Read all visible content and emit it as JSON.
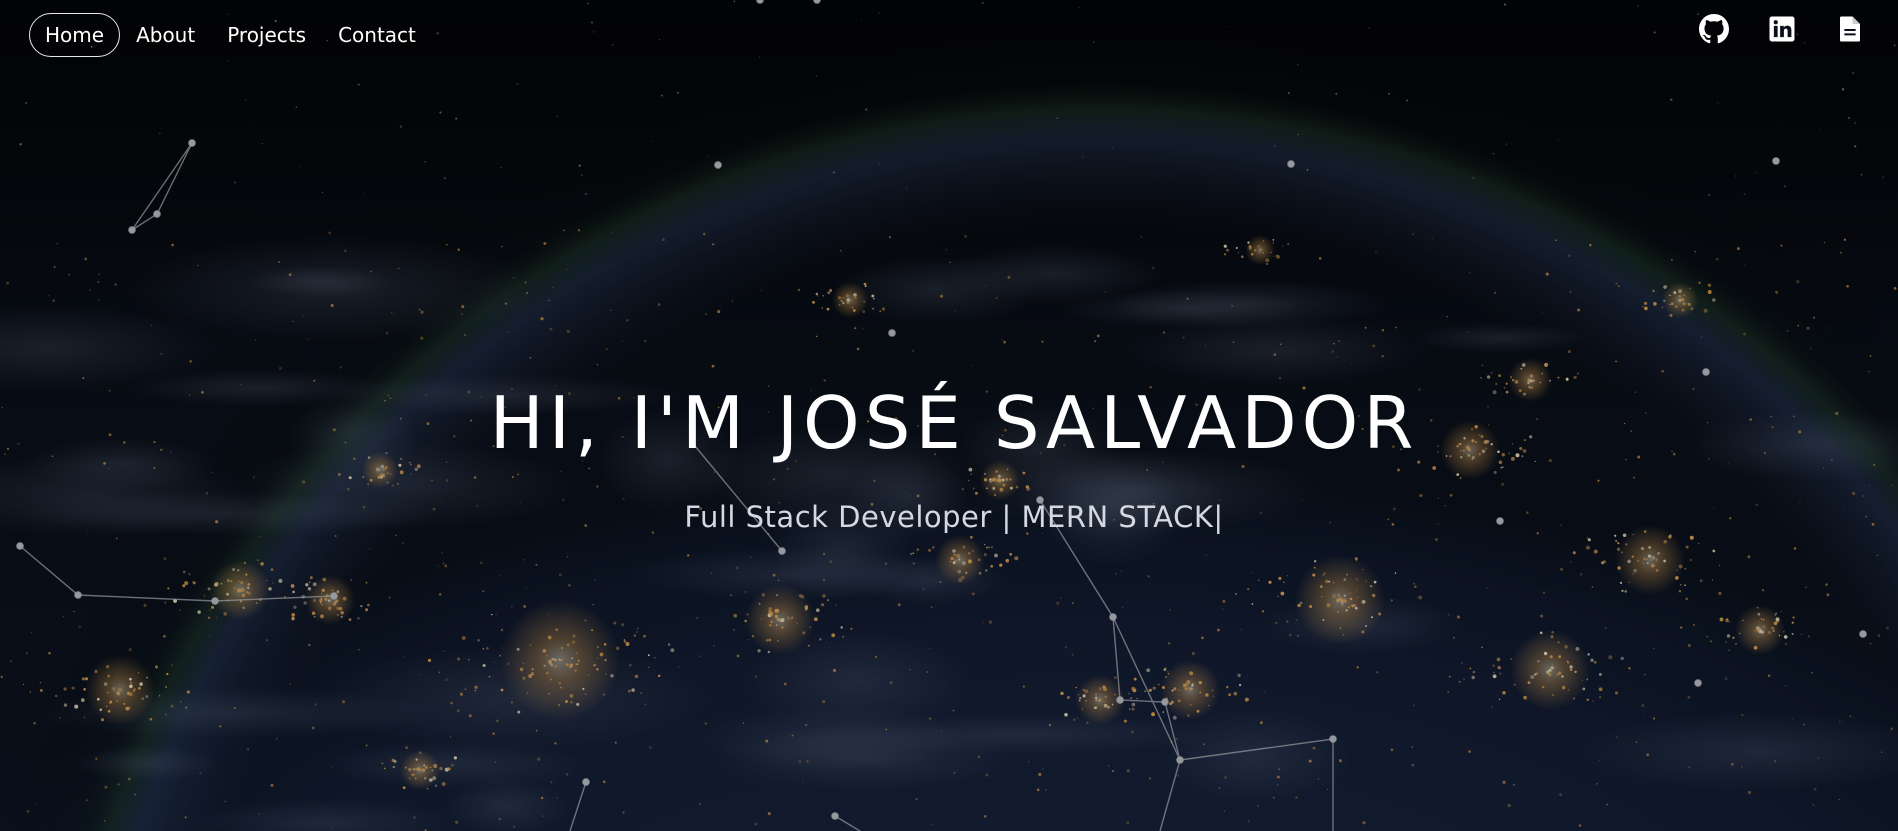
{
  "nav": {
    "items": [
      {
        "label": "Home",
        "active": true
      },
      {
        "label": "About",
        "active": false
      },
      {
        "label": "Projects",
        "active": false
      },
      {
        "label": "Contact",
        "active": false
      }
    ]
  },
  "social": {
    "icons": [
      "github-icon",
      "linkedin-icon",
      "resume-document-icon"
    ]
  },
  "hero": {
    "title": "HI, I'M JOSÉ SALVADOR",
    "subtitle": "Full Stack Developer | MERN STACK|"
  },
  "colors": {
    "text": "#ffffff",
    "subtitle": "#d4d8e0",
    "background": "#05070c",
    "city_lights": "#f2b25c",
    "constellation": "#c9ccd3"
  }
}
